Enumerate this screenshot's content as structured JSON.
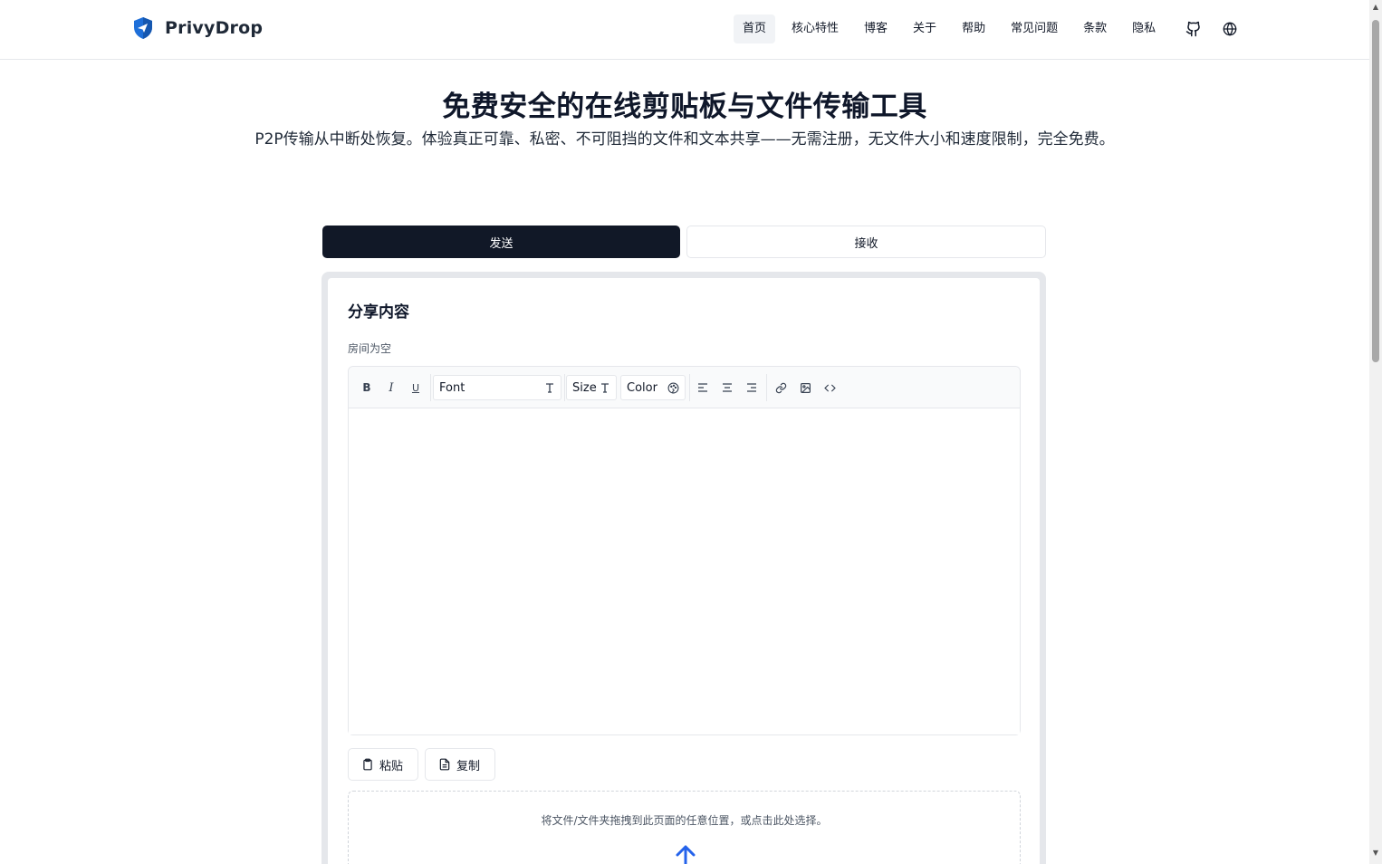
{
  "brand": {
    "name": "PrivyDrop"
  },
  "nav": {
    "items": [
      "首页",
      "核心特性",
      "博客",
      "关于",
      "帮助",
      "常见问题",
      "条款",
      "隐私"
    ],
    "active_index": 0,
    "icons": [
      "github-icon",
      "globe-icon"
    ]
  },
  "hero": {
    "title": "免费安全的在线剪贴板与文件传输工具",
    "subtitle": "P2P传输从中断处恢复。体验真正可靠、私密、不可阻挡的文件和文本共享——无需注册，无文件大小和速度限制，完全免费。"
  },
  "tabs": {
    "send": "发送",
    "receive": "接收",
    "active": "send"
  },
  "card": {
    "title": "分享内容",
    "room_status": "房间为空"
  },
  "toolbar": {
    "bold": "B",
    "italic": "I",
    "underline": "U",
    "font_label": "Font",
    "size_label": "Size",
    "color_label": "Color",
    "icons": [
      "bold-icon",
      "italic-icon",
      "underline-icon",
      "font-icon",
      "text-size-icon",
      "palette-icon",
      "align-left-icon",
      "align-center-icon",
      "align-right-icon",
      "link-icon",
      "image-icon",
      "code-icon"
    ]
  },
  "actions": {
    "paste": "粘贴",
    "copy": "复制"
  },
  "dropzone": {
    "text": "将文件/文件夹拖拽到此页面的任意位置，或点击此处选择。",
    "icon": "upload-arrow-icon"
  },
  "colors": {
    "primary": "#111827",
    "accent": "#2563eb",
    "logo_blue": "#1e6fd9"
  }
}
